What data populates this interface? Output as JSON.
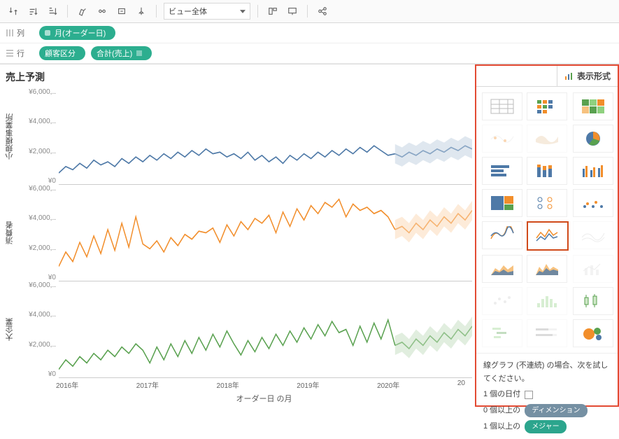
{
  "toolbar": {
    "view_dropdown": "ビュー全体"
  },
  "shelves": {
    "columns_label": "列",
    "rows_label": "行",
    "columns_pills": [
      "月(オーダー日)"
    ],
    "rows_pills": [
      "顧客区分",
      "合計(売上)"
    ]
  },
  "viz": {
    "title": "売上予測",
    "row_headers": [
      "小規模事業所",
      "消費者",
      "大企業"
    ],
    "y_ticks": [
      "¥6,000,..",
      "¥4,000,..",
      "¥2,000,..",
      "¥0"
    ],
    "x_ticks": [
      "2016年",
      "2017年",
      "2018年",
      "2019年",
      "2020年",
      "20"
    ],
    "x_axis_title": "オーダー日 の月"
  },
  "panel": {
    "tab_label": "表示形式",
    "chart_types": [
      {
        "name": "table",
        "dim": false
      },
      {
        "name": "heatmap",
        "dim": false
      },
      {
        "name": "highlight-table",
        "dim": false
      },
      {
        "name": "symbol-map",
        "dim": true
      },
      {
        "name": "filled-map",
        "dim": true
      },
      {
        "name": "pie",
        "dim": false
      },
      {
        "name": "hbar",
        "dim": false
      },
      {
        "name": "stacked-bar",
        "dim": false
      },
      {
        "name": "side-by-side-bar",
        "dim": false
      },
      {
        "name": "treemap",
        "dim": false
      },
      {
        "name": "circle-views",
        "dim": false
      },
      {
        "name": "side-by-side-circle",
        "dim": false
      },
      {
        "name": "line-continuous",
        "dim": false
      },
      {
        "name": "line-discrete",
        "dim": false,
        "selected": true
      },
      {
        "name": "line-dim",
        "dim": true
      },
      {
        "name": "area-continuous",
        "dim": false
      },
      {
        "name": "area-discrete",
        "dim": false
      },
      {
        "name": "dual-line",
        "dim": true
      },
      {
        "name": "scatter",
        "dim": true
      },
      {
        "name": "histogram",
        "dim": true
      },
      {
        "name": "box-plot",
        "dim": false
      },
      {
        "name": "gantt",
        "dim": true
      },
      {
        "name": "bullet",
        "dim": true
      },
      {
        "name": "packed-bubbles",
        "dim": false
      }
    ],
    "guide_title": "線グラフ (不連続) の場合、次を試してください。",
    "req1_prefix": "1 個の日付",
    "req2_prefix": "0 個以上の",
    "req2_pill": "ディメンション",
    "req3_prefix": "1 個以上の",
    "req3_pill": "メジャー"
  },
  "chart_data": [
    {
      "type": "line",
      "series_name": "小規模事業所",
      "color": "#4e79a7",
      "xlabel": "オーダー日 の月",
      "ylabel": "売上",
      "ylim": [
        0,
        6000000
      ],
      "x_range": [
        "2016-01",
        "2020-12"
      ],
      "forecast_from": "2020-01",
      "values": [
        700000,
        1100000,
        900000,
        1300000,
        1000000,
        1500000,
        1200000,
        1400000,
        1100000,
        1600000,
        1300000,
        1700000,
        1400000,
        1800000,
        1500000,
        1900000,
        1600000,
        2000000,
        1700000,
        2100000,
        1800000,
        2200000,
        1900000,
        2000000,
        1700000,
        1900000,
        1600000,
        2000000,
        1500000,
        1800000,
        1400000,
        1700000,
        1300000,
        1800000,
        1500000,
        1900000,
        1600000,
        2000000,
        1700000,
        2100000,
        1800000,
        2200000,
        1900000,
        2300000,
        2000000,
        2400000,
        2100000,
        1800000,
        1900000,
        1700000,
        2000000,
        1800000,
        2100000,
        1900000,
        2200000,
        2000000,
        2300000,
        2100000,
        2400000,
        2200000
      ]
    },
    {
      "type": "line",
      "series_name": "消費者",
      "color": "#f28e2b",
      "xlabel": "オーダー日 の月",
      "ylabel": "売上",
      "ylim": [
        0,
        6000000
      ],
      "x_range": [
        "2016-01",
        "2020-12"
      ],
      "forecast_from": "2020-01",
      "values": [
        900000,
        1800000,
        1200000,
        2400000,
        1500000,
        2800000,
        1700000,
        3200000,
        1900000,
        3600000,
        2100000,
        4000000,
        2300000,
        2000000,
        2500000,
        1800000,
        2700000,
        2200000,
        2900000,
        2600000,
        3100000,
        3000000,
        3300000,
        2400000,
        3500000,
        2800000,
        3700000,
        3200000,
        3900000,
        3600000,
        4100000,
        3000000,
        4300000,
        3400000,
        4500000,
        3800000,
        4700000,
        4200000,
        4900000,
        4600000,
        5100000,
        4000000,
        4800000,
        4400000,
        4600000,
        4200000,
        4400000,
        4000000,
        3200000,
        3400000,
        3000000,
        3600000,
        3200000,
        3800000,
        3400000,
        4000000,
        3600000,
        4200000,
        3800000,
        4400000
      ]
    },
    {
      "type": "line",
      "series_name": "大企業",
      "color": "#59a14f",
      "xlabel": "オーダー日 の月",
      "ylabel": "売上",
      "ylim": [
        0,
        6000000
      ],
      "x_range": [
        "2016-01",
        "2020-12"
      ],
      "forecast_from": "2020-01",
      "values": [
        500000,
        1100000,
        700000,
        1300000,
        900000,
        1500000,
        1100000,
        1700000,
        1300000,
        1900000,
        1500000,
        2100000,
        1700000,
        900000,
        1900000,
        1100000,
        2100000,
        1300000,
        2300000,
        1500000,
        2500000,
        1700000,
        2700000,
        1900000,
        2900000,
        2100000,
        1400000,
        2300000,
        1600000,
        2500000,
        1800000,
        2700000,
        2000000,
        2900000,
        2200000,
        3100000,
        2400000,
        3300000,
        2600000,
        3500000,
        2800000,
        3000000,
        2000000,
        3200000,
        2200000,
        3400000,
        2400000,
        3600000,
        2000000,
        2200000,
        1800000,
        2400000,
        2000000,
        2600000,
        2200000,
        2800000,
        2400000,
        3000000,
        2600000,
        3200000
      ]
    }
  ]
}
